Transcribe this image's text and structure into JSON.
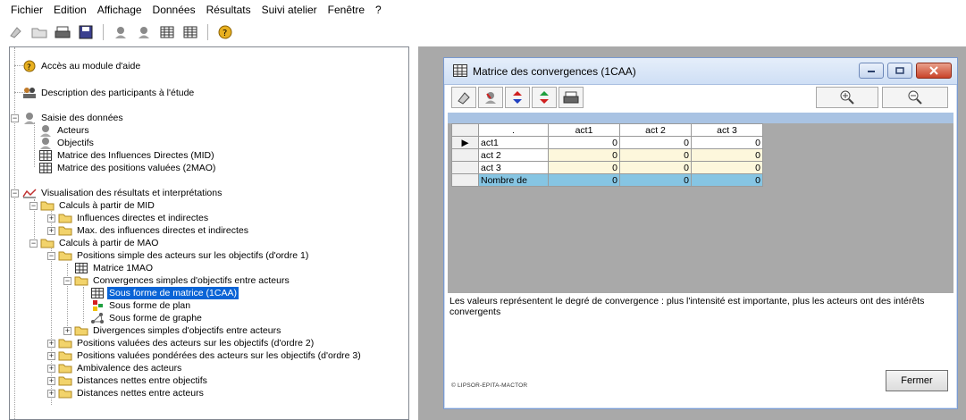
{
  "menu": [
    "Fichier",
    "Edition",
    "Affichage",
    "Données",
    "Résultats",
    "Suivi atelier",
    "Fenêtre",
    "?"
  ],
  "tree": {
    "help": "Accès au module d'aide",
    "participants": "Description des participants à l'étude",
    "saisie": "Saisie des données",
    "acteurs": "Acteurs",
    "objectifs": "Objectifs",
    "mid": "Matrice des Influences Directes (MID)",
    "mao2": "Matrice des positions valuées (2MAO)",
    "visu": "Visualisation des résultats et interprétations",
    "calc_mid": "Calculs à partir de MID",
    "influences": "Influences directes et indirectes",
    "max_influences": "Max. des influences directes et indirectes",
    "calc_mao": "Calculs à partir de MAO",
    "positions_simple": "Positions simple des acteurs sur les objectifs (d'ordre 1)",
    "matrice_1mao": "Matrice 1MAO",
    "convergences": "Convergences simples d'objectifs entre acteurs",
    "sous_matrice": "Sous forme de matrice (1CAA)",
    "sous_plan": "Sous forme de plan",
    "sous_graphe": "Sous forme de graphe",
    "divergences": "Divergences simples d'objectifs entre acteurs",
    "positions_valuees": "Positions valuées des acteurs sur les objectifs (d'ordre 2)",
    "positions_ponderees": "Positions valuées pondérées des acteurs sur les objectifs (d'ordre 3)",
    "ambivalence": "Ambivalence des acteurs",
    "dist_objectifs": "Distances nettes entre objectifs",
    "dist_acteurs": "Distances nettes entre acteurs"
  },
  "dialog": {
    "title": "Matrice des convergences (1CAA)",
    "corner": ".",
    "columns": [
      "act1",
      "act 2",
      "act 3"
    ],
    "rows": [
      {
        "label": "act1",
        "values": [
          "0",
          "0",
          "0"
        ],
        "marker": "▶"
      },
      {
        "label": "act 2",
        "values": [
          "0",
          "0",
          "0"
        ],
        "marker": ""
      },
      {
        "label": "act 3",
        "values": [
          "0",
          "0",
          "0"
        ],
        "marker": ""
      },
      {
        "label": "Nombre de",
        "values": [
          "0",
          "0",
          "0"
        ],
        "marker": ""
      }
    ],
    "description": "Les valeurs représentent le degré de convergence : plus l'intensité est importante, plus les acteurs ont des intérêts convergents",
    "copyright": "© LIPSOR-EPITA-MACTOR",
    "close_label": "Fermer"
  },
  "colors": {
    "selection": "#0a64d6",
    "total_row": "#86c5e3",
    "cell_yellow": "#fdf7dc",
    "workspace": "#a9a9a9"
  }
}
